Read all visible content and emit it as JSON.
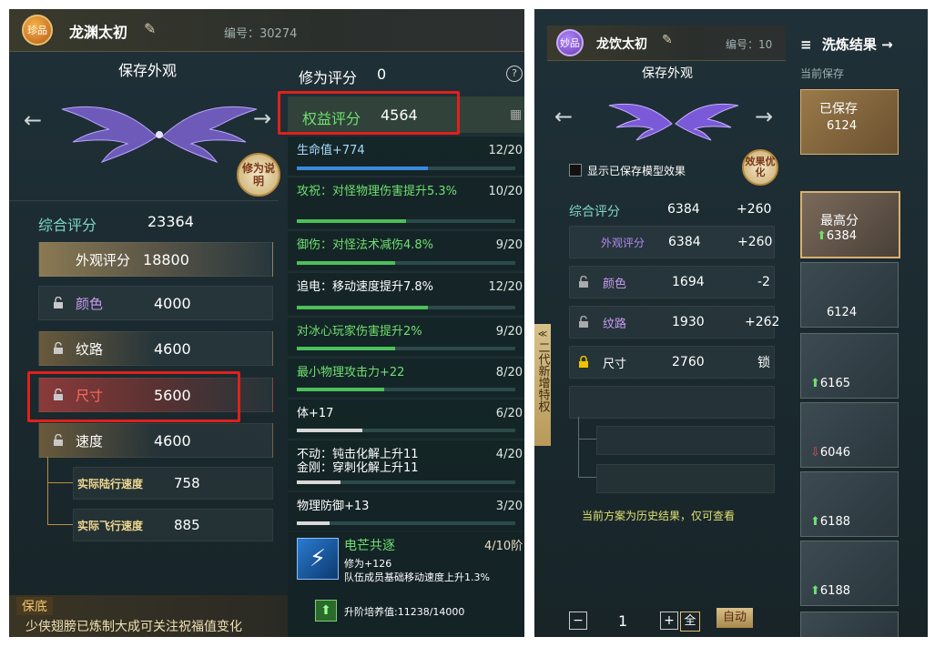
{
  "left": {
    "rarity_badge": "珍品",
    "name": "龙渊太初",
    "id_label": "编号：30274",
    "save_title": "保存外观",
    "help_button": "修为说明",
    "composite_label": "综合评分",
    "composite_value": "23364",
    "appearance_label": "外观评分",
    "appearance_value": "18800",
    "rows": [
      {
        "label": "颜色",
        "value": "4000"
      },
      {
        "label": "纹路",
        "value": "4600"
      },
      {
        "label": "尺寸",
        "value": "5600"
      },
      {
        "label": "速度",
        "value": "4600"
      }
    ],
    "sub_rows": [
      {
        "label": "实际陆行速度",
        "value": "758"
      },
      {
        "label": "实际飞行速度",
        "value": "885"
      }
    ],
    "guarantee_label": "保底",
    "guarantee_text": "少侠翅膀已炼制大成可关注祝福值变化",
    "cultivation_label": "修为评分",
    "cultivation_value": "0",
    "rights_label": "权益评分",
    "rights_value": "4564",
    "stats": [
      {
        "text": "生命值+774",
        "count": "12/20",
        "fill": 0.6,
        "color": "#3a8be0"
      },
      {
        "text": "攻祝：对怪物理伤害提升5.3%",
        "count": "10/20",
        "fill": 0.5,
        "color": "#4cc05a"
      },
      {
        "text": "御伤：对怪法术减伤4.8%",
        "count": "9/20",
        "fill": 0.45,
        "color": "#4cc05a"
      },
      {
        "text": "追电：移动速度提升7.8%",
        "count": "12/20",
        "fill": 0.6,
        "color": "#4cc05a"
      },
      {
        "text": "对冰心玩家伤害提升2%",
        "count": "9/20",
        "fill": 0.45,
        "color": "#4cc05a"
      },
      {
        "text": "最小物理攻击力+22",
        "count": "8/20",
        "fill": 0.4,
        "color": "#4cc05a"
      },
      {
        "text": "体+17",
        "count": "6/20",
        "fill": 0.3,
        "color": "#d8d8d8"
      },
      {
        "text": "不动：钝击化解上升11",
        "text2": "金刚：穿刺化解上升11",
        "count": "4/20",
        "fill": 0.2,
        "color": "#d8d8d8"
      },
      {
        "text": "物理防御+13",
        "count": "3/20",
        "fill": 0.15,
        "color": "#d8d8d8"
      }
    ],
    "skill": {
      "name": "电芒共逐",
      "stage": "4/10阶",
      "line1": "修为+126",
      "line2": "队伍成员基础移动速度上升1.3%",
      "cultivate": "升阶培养值:11238/14000"
    }
  },
  "right": {
    "rarity_badge": "妙品",
    "name": "龙饮太初",
    "id_label": "编号：10",
    "save_title": "保存外观",
    "checkbox_label": "显示已保存模型效果",
    "effect_button": "效果优化",
    "composite_label": "综合评分",
    "composite_value": "6384",
    "composite_delta": "+260",
    "appearance_label": "外观评分",
    "appearance_value": "6384",
    "appearance_delta": "+260",
    "rows": [
      {
        "label": "颜色",
        "value": "1694",
        "delta": "-2"
      },
      {
        "label": "纹路",
        "value": "1930",
        "delta": "+262"
      },
      {
        "label": "尺寸",
        "value": "2760",
        "delta": "锁"
      }
    ],
    "history_note": "当前方案为历史结果，仅可查看",
    "side_tab": "二代新增特权",
    "qty_minus": "−",
    "qty_value": "1",
    "qty_plus": "+",
    "all_button": "全",
    "auto_button": "自动",
    "results_title": "洗炼结果",
    "current_save": "当前保存",
    "saved_label": "已保存",
    "saved_value": "6124",
    "highest_label": "最高分",
    "highest_value": "6384",
    "results": [
      {
        "value": "6124",
        "trend": "none"
      },
      {
        "value": "6165",
        "trend": "up"
      },
      {
        "value": "6046",
        "trend": "down"
      },
      {
        "value": "6188",
        "trend": "up"
      },
      {
        "value": "6188",
        "trend": "up"
      }
    ]
  }
}
